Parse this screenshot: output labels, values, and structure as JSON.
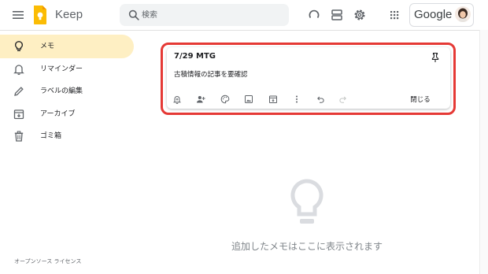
{
  "header": {
    "app_title": "Keep",
    "search_placeholder": "検索",
    "account_brand": "Google"
  },
  "sidebar": {
    "items": [
      {
        "label": "メモ",
        "icon": "lightbulb-icon",
        "active": true
      },
      {
        "label": "リマインダー",
        "icon": "bell-icon",
        "active": false
      },
      {
        "label": "ラベルの編集",
        "icon": "pencil-icon",
        "active": false
      },
      {
        "label": "アーカイブ",
        "icon": "archive-icon",
        "active": false
      },
      {
        "label": "ゴミ箱",
        "icon": "trash-icon",
        "active": false
      }
    ],
    "footer_link": "オープンソース ライセンス"
  },
  "note": {
    "title": "7/29 MTG",
    "body": "古積情報の記事を要確認",
    "close_label": "閉じる",
    "toolbar_icons": [
      "bell-plus-icon",
      "add-person-icon",
      "palette-icon",
      "image-icon",
      "archive-icon",
      "more-vert-icon",
      "undo-icon",
      "redo-icon"
    ]
  },
  "empty_state": {
    "message": "追加したメモはここに表示されます"
  },
  "colors": {
    "active_nav": "#feefc3",
    "highlight_border": "#e53935",
    "keep_yellow": "#fbbc04"
  }
}
